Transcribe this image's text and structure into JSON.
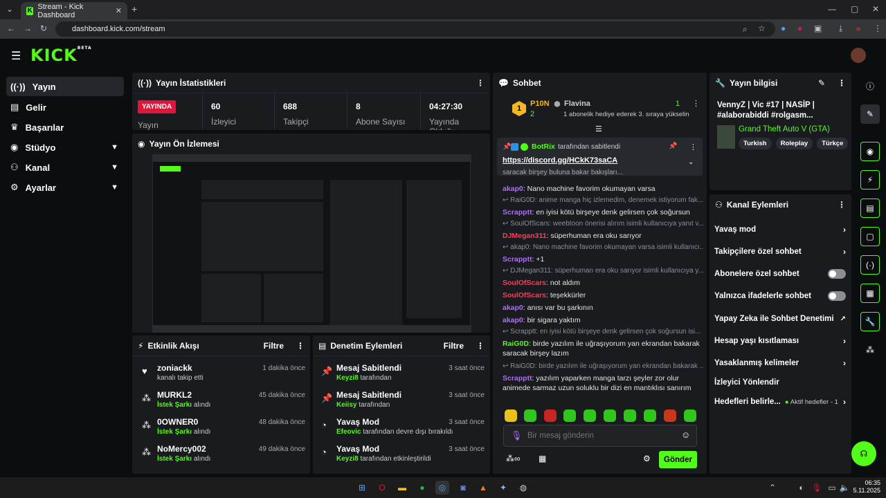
{
  "browser": {
    "tab_title": "Stream - Kick Dashboard",
    "url": "dashboard.kick.com/stream"
  },
  "header": {
    "logo": "KICK",
    "logo_badge": "BETA"
  },
  "sidebar": {
    "items": [
      {
        "label": "Yayın",
        "icon": "broadcast-icon"
      },
      {
        "label": "Gelir",
        "icon": "revenue-icon"
      },
      {
        "label": "Başarılar",
        "icon": "trophy-icon"
      },
      {
        "label": "Stüdyo",
        "icon": "studio-icon"
      },
      {
        "label": "Kanal",
        "icon": "channel-icon"
      },
      {
        "label": "Ayarlar",
        "icon": "settings-icon"
      }
    ]
  },
  "stats": {
    "title": "Yayın İstatistikleri",
    "live_badge": "YAYINDA",
    "live_label": "Yayın",
    "viewers_value": "60",
    "viewers_label": "İzleyici",
    "followers_value": "688",
    "followers_label": "Takipçi",
    "subs_value": "8",
    "subs_label": "Abone Sayısı",
    "uptime_value": "04:27:30",
    "uptime_label": "Yayında Olduğu"
  },
  "preview": {
    "title": "Yayın Ön İzlemesi"
  },
  "activity": {
    "title": "Etkinlik Akışı",
    "filter": "Filtre",
    "rows": [
      {
        "name": "zoniackk",
        "sub": "kanalı takip etti",
        "hl": "",
        "time": "1 dakika önce"
      },
      {
        "name": "MURKL2",
        "hl": "İstek Şarkı",
        "sub": "alındı",
        "time": "45 dakika önce"
      },
      {
        "name": "0OWNER0",
        "hl": "İstek Şarkı",
        "sub": "alındı",
        "time": "48 dakika önce"
      },
      {
        "name": "NoMercy002",
        "hl": "İstek Şarkı",
        "sub": "alındı",
        "time": "49 dakika önce"
      }
    ]
  },
  "moderation": {
    "title": "Denetim Eylemleri",
    "filter": "Filtre",
    "rows": [
      {
        "name": "Mesaj Sabitlendi",
        "hl": "Keyzi8",
        "sub": "tarafından",
        "time": "3 saat önce"
      },
      {
        "name": "Mesaj Sabitlendi",
        "hl": "Keiisy",
        "sub": "tarafından",
        "time": "3 saat önce"
      },
      {
        "name": "Yavaş Mod",
        "hl": "Efeovic",
        "sub": "tarafından devre dışı bırakıldı",
        "time": "3 saat önce"
      },
      {
        "name": "Yavaş Mod",
        "hl": "Keyzi8",
        "sub": "tarafından etkinleştirildi",
        "time": "3 saat önce"
      }
    ]
  },
  "chat": {
    "title": "Sohbet",
    "top_user": "P10N",
    "top_count": "2",
    "gift_user": "Flavina",
    "gift_count": "1",
    "gift_text": "1 abonelik hediye ederek 3. sıraya yükselin",
    "pinned_by": "BotRix",
    "pinned_suffix": "tarafından sabitlendi",
    "pinned_link": "https://discord.gg/HCkK73saCA",
    "partial_line": "saracak birşey buluna bakar bakışları...",
    "messages": [
      {
        "type": "msg",
        "user": "akap0",
        "color": "#b06cff",
        "text": "Nano machine favorim okumayan varsa"
      },
      {
        "type": "reply",
        "text": "RaiG0D: anime manga hiç izlemedim, denemek istiyorum fak..."
      },
      {
        "type": "msg",
        "user": "Scrapptt",
        "color": "#b06cff",
        "text": "en iyisi kötü birşeye denk gelirsen çok soğursun"
      },
      {
        "type": "reply",
        "text": "SoulOfScars: weebtoon önerisi alırım isimli kullanıcıya yanıt v..."
      },
      {
        "type": "msg",
        "user": "DJMegan311",
        "color": "#ff3b5b",
        "text": "süperhuman era oku sarıyor"
      },
      {
        "type": "reply",
        "text": "akap0: Nano machine favorim okumayan varsa isimli kullanıcı..."
      },
      {
        "type": "msg",
        "user": "Scrapptt",
        "color": "#b06cff",
        "text": "+1"
      },
      {
        "type": "reply",
        "text": "DJMegan311: süperhuman era oku sarıyor isimli kullanıcıya y..."
      },
      {
        "type": "msg",
        "user": "SoulOfScars",
        "color": "#ff3b5b",
        "text": "not aldım"
      },
      {
        "type": "msg",
        "user": "SoulOfScars",
        "color": "#ff3b5b",
        "text": "teşekkürler"
      },
      {
        "type": "msg",
        "user": "akap0",
        "color": "#b06cff",
        "text": "anısı var bu şarkının"
      },
      {
        "type": "msg",
        "user": "akap0",
        "color": "#b06cff",
        "text": "bir sigara yaktım"
      },
      {
        "type": "reply",
        "text": "Scrapptt: en iyisi kötü birşeye denk gelirsen çok soğursun isi..."
      },
      {
        "type": "msg",
        "user": "RaiG0D",
        "color": "#53fc18",
        "text": "birde yazılım ile uğraşıyorum yan ekrandan bakarak saracak birşey lazım"
      },
      {
        "type": "reply",
        "text": "RaiG0D: birde yazılım ile uğraşıyorum yan ekrandan bakarak ..."
      },
      {
        "type": "msg",
        "user": "Scrapptt",
        "color": "#b06cff",
        "text": "yazılım yaparken manga tarzı şeyler zor olur animede sarmaz uzun soluklu bir dizi en mantıklısı sanırım"
      }
    ],
    "input_placeholder": "Bir mesaj gönderin",
    "send": "Gönder"
  },
  "stream_info": {
    "title": "Yayın bilgisi",
    "stream_title": "VennyZ | Vic #17 | NASİP | #alaborabiddi #rolgasm...",
    "category": "Grand Theft Auto V (GTA)",
    "tags": [
      "Turkish",
      "Roleplay",
      "Türkçe"
    ]
  },
  "channel_actions": {
    "title": "Kanal Eylemleri",
    "rows": [
      {
        "label": "Yavaş mod",
        "kind": "arrow"
      },
      {
        "label": "Takipçilere özel sohbet",
        "kind": "arrow"
      },
      {
        "label": "Abonelere özel sohbet",
        "kind": "toggle"
      },
      {
        "label": "Yalnızca ifadelerle sohbet",
        "kind": "toggle"
      },
      {
        "label": "Yapay Zeka ile Sohbet Denetimi",
        "kind": "external"
      },
      {
        "label": "Hesap yaşı kısıtlaması",
        "kind": "arrow"
      },
      {
        "label": "Yasaklanmış kelimeler",
        "kind": "arrow"
      },
      {
        "label": "İzleyici Yönlendir",
        "kind": "none"
      },
      {
        "label": "Hedefleri belirle...",
        "kind": "goal",
        "extra": "Aktif hedefler - 1"
      }
    ]
  },
  "taskbar": {
    "time": "06:35",
    "date": "5.11.2025"
  },
  "colors": {
    "accent": "#53fc18",
    "panel": "#191b1f",
    "bg": "#0b0e0f",
    "live": "#e2143a"
  }
}
